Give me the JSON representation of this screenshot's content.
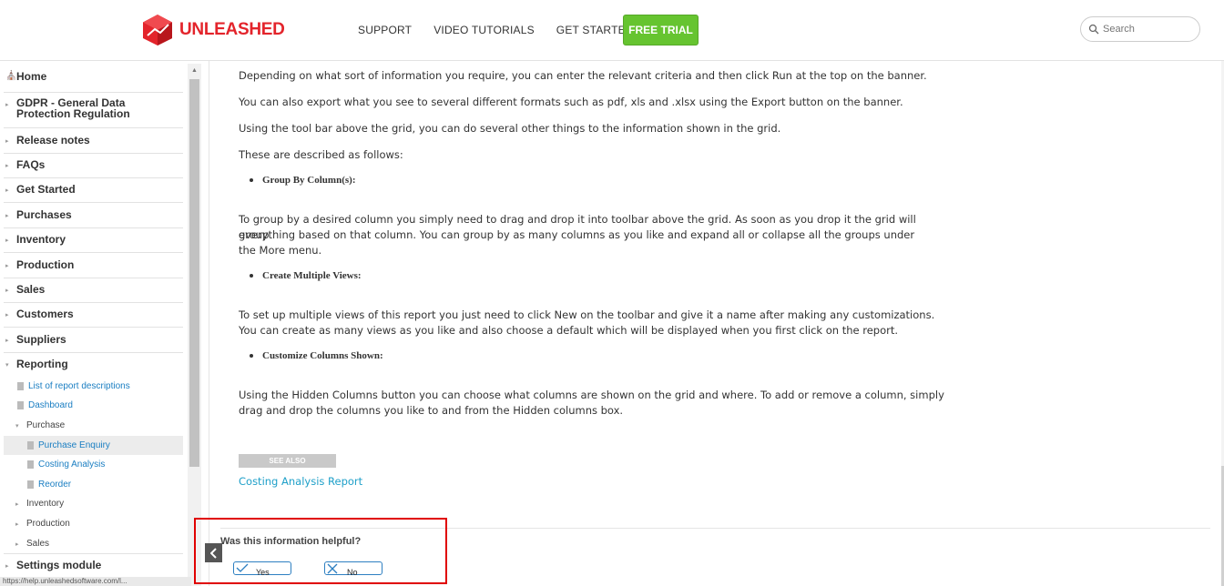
{
  "header": {
    "brand": "UNLEASHED",
    "nav": [
      "SUPPORT",
      "VIDEO TUTORIALS",
      "GET STARTED"
    ],
    "cta": "FREE TRIAL",
    "search_placeholder": "Search"
  },
  "colors": {
    "brand_red": "#e3242b",
    "cta_green": "#66c430",
    "link_blue": "#1a7ec2",
    "highlight_border": "#e00000"
  },
  "sidebar": {
    "home": "Home",
    "gdpr": "GDPR - General Data Protection Regulation",
    "items": [
      "Release notes",
      "FAQs",
      "Get Started",
      "Purchases",
      "Inventory",
      "Production",
      "Sales",
      "Customers",
      "Suppliers",
      "Reporting"
    ],
    "reporting_children": {
      "list": "List of report descriptions",
      "dashboard": "Dashboard",
      "purchase": "Purchase",
      "purchase_enquiry": "Purchase Enquiry",
      "costing_analysis": "Costing Analysis",
      "reorder": "Reorder",
      "inventory": "Inventory",
      "production": "Production",
      "sales": "Sales"
    },
    "settings": "Settings module",
    "status_url": "https://help.unleashedsoftware.com/l..."
  },
  "content": {
    "p1": "Depending on what sort of information you require, you can enter the relevant criteria and then click Run at the top on the banner.",
    "p2": "You can also export what you see to several different formats such as pdf, xls and .xlsx using the Export button on the banner.",
    "p3": "Using the tool bar above the grid, you can do several other things to the information shown in the grid.",
    "p4": "These are described as follows:",
    "b1": "Group By Column(s):",
    "p5a": "To group by a desired column you simply need to drag and drop it into toolbar above the grid. As soon as you drop it the grid will group",
    "p5b": "everything based on that column. You can group by as many columns as you like and expand all or collapse all the groups under",
    "p5c": "the More menu.",
    "b2": "Create Multiple Views:",
    "p6a": "To set up multiple views of this report you just need to click New on the toolbar and give it a name after making any customizations.",
    "p6b": "You can create as many views as you like and also choose a default which will be displayed when you first click on the report.",
    "b3": "Customize Columns Shown:",
    "p7a": "Using the Hidden Columns button you can choose what columns are shown on the grid and where. To add or remove a column, simply",
    "p7b": "drag and drop the columns you like to and from the Hidden columns box.",
    "see_also": "SEE ALSO",
    "see_link": "Costing Analysis Report"
  },
  "feedback": {
    "question": "Was this information helpful?",
    "yes": "Yes",
    "no": "No"
  }
}
